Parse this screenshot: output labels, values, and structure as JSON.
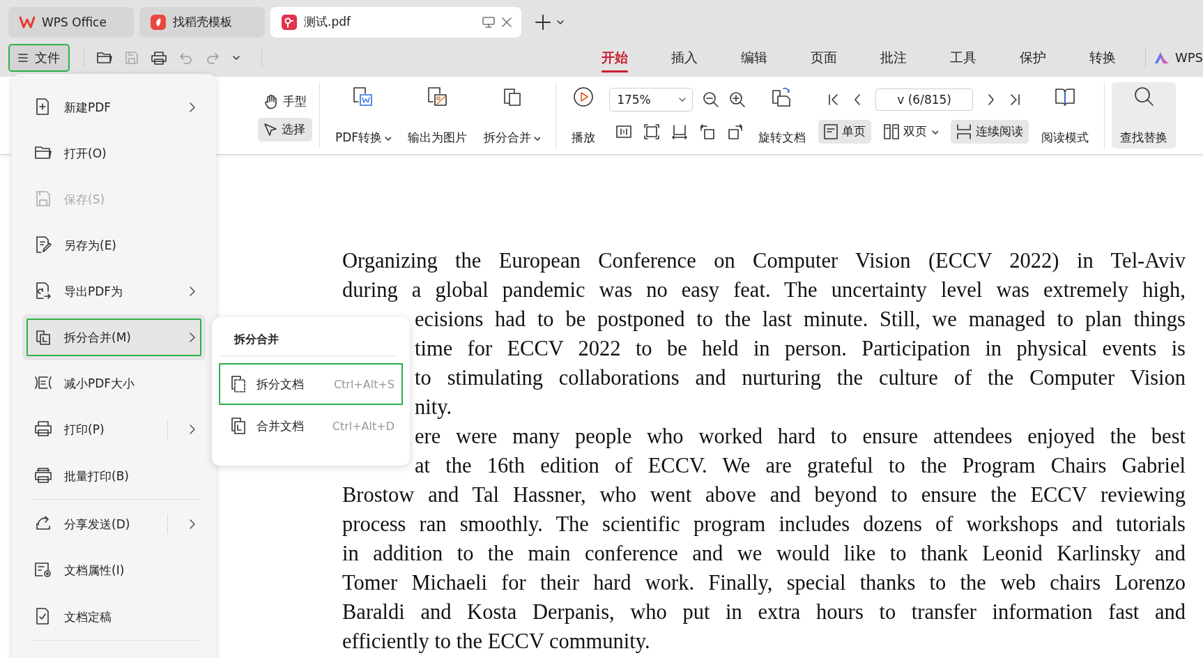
{
  "tabs": [
    {
      "label": "WPS Office",
      "selected": false,
      "closable": false
    },
    {
      "label": "找稻壳模板",
      "selected": false,
      "closable": false
    },
    {
      "label": "测试.pdf",
      "selected": true,
      "closable": true
    }
  ],
  "file_button": {
    "label": "文件",
    "highlighted": true
  },
  "ribbon_tabs": [
    {
      "label": "开始",
      "selected": true
    },
    {
      "label": "插入",
      "selected": false
    },
    {
      "label": "编辑",
      "selected": false
    },
    {
      "label": "页面",
      "selected": false
    },
    {
      "label": "批注",
      "selected": false
    },
    {
      "label": "工具",
      "selected": false
    },
    {
      "label": "保护",
      "selected": false
    },
    {
      "label": "转换",
      "selected": false
    }
  ],
  "account": "WPS",
  "ribbon": {
    "hand": {
      "label": "手型",
      "selected": false
    },
    "select": {
      "label": "选择",
      "selected": true
    },
    "big_buttons": [
      {
        "label": "PDF转换",
        "has_menu": true
      },
      {
        "label": "输出为图片",
        "has_menu": false
      },
      {
        "label": "拆分合并",
        "has_menu": true
      },
      {
        "label": "播放",
        "has_menu": false
      }
    ],
    "zoom": "175%",
    "rotate": "旋转文档",
    "page_field": "v (6/815)",
    "view_buttons": [
      {
        "label": "单页",
        "selected": true,
        "has_menu": false
      },
      {
        "label": "双页",
        "selected": false,
        "has_menu": true
      },
      {
        "label": "连续阅读",
        "selected": true,
        "has_menu": false
      }
    ],
    "read_mode": "阅读模式",
    "find": {
      "label": "查找替换",
      "selected": true
    }
  },
  "file_menu": [
    {
      "label": "新建PDF",
      "disabled": false,
      "submenu": true,
      "split": false,
      "highlighted": false,
      "separator_after": false
    },
    {
      "label": "打开(O)",
      "disabled": false,
      "submenu": false,
      "split": false,
      "highlighted": false,
      "separator_after": false
    },
    {
      "label": "保存(S)",
      "disabled": true,
      "submenu": false,
      "split": false,
      "highlighted": false,
      "separator_after": false
    },
    {
      "label": "另存为(E)",
      "disabled": false,
      "submenu": false,
      "split": false,
      "highlighted": false,
      "separator_after": false
    },
    {
      "label": "导出PDF为",
      "disabled": false,
      "submenu": true,
      "split": false,
      "highlighted": false,
      "separator_after": false
    },
    {
      "label": "拆分合并(M)",
      "disabled": false,
      "submenu": true,
      "split": false,
      "highlighted": true,
      "separator_after": false
    },
    {
      "label": "减小PDF大小",
      "disabled": false,
      "submenu": false,
      "split": false,
      "highlighted": false,
      "separator_after": false
    },
    {
      "label": "打印(P)",
      "disabled": false,
      "submenu": true,
      "split": true,
      "highlighted": false,
      "separator_after": false
    },
    {
      "label": "批量打印(B)",
      "disabled": false,
      "submenu": false,
      "split": false,
      "highlighted": false,
      "separator_after": true
    },
    {
      "label": "分享发送(D)",
      "disabled": false,
      "submenu": true,
      "split": true,
      "highlighted": false,
      "separator_after": false
    },
    {
      "label": "文档属性(I)",
      "disabled": false,
      "submenu": false,
      "split": false,
      "highlighted": false,
      "separator_after": false
    },
    {
      "label": "文档定稿",
      "disabled": false,
      "submenu": false,
      "split": false,
      "highlighted": false,
      "separator_after": true
    }
  ],
  "submenu": {
    "title": "拆分合并",
    "items": [
      {
        "label": "拆分文档",
        "shortcut": "Ctrl+Alt+S",
        "selected": true
      },
      {
        "label": "合并文档",
        "shortcut": "Ctrl+Alt+D",
        "selected": false
      }
    ]
  },
  "document_lines": [
    {
      "text": "Organizing the European Conference on Computer Vision (ECCV 2022) in Tel-Aviv",
      "covered": false,
      "paragraph_end": false
    },
    {
      "text": "during a global pandemic was no easy feat. The uncertainty level was extremely high,",
      "covered": false,
      "paragraph_end": false
    },
    {
      "text": "ecisions had to be postponed to the last minute. Still, we managed to plan things",
      "covered": true,
      "paragraph_end": false
    },
    {
      "text": "time for ECCV 2022 to be held in person. Participation in physical events is",
      "covered": true,
      "paragraph_end": false
    },
    {
      "text": "to stimulating collaborations and nurturing the culture of the Computer Vision",
      "covered": true,
      "paragraph_end": false
    },
    {
      "text": "nity.",
      "covered": true,
      "paragraph_end": true
    },
    {
      "text": "ere were many people who worked hard to ensure attendees enjoyed the best",
      "covered": true,
      "paragraph_end": false
    },
    {
      "text": "at the 16th edition of ECCV. We are grateful to the Program Chairs Gabriel",
      "covered": true,
      "paragraph_end": false
    },
    {
      "text": "Brostow and Tal Hassner, who went above and beyond to ensure the ECCV reviewing",
      "covered": false,
      "paragraph_end": false
    },
    {
      "text": "process ran smoothly. The scientific program includes dozens of workshops and tutorials",
      "covered": false,
      "paragraph_end": false
    },
    {
      "text": "in addition to the main conference and we would like to thank Leonid Karlinsky and",
      "covered": false,
      "paragraph_end": false
    },
    {
      "text": "Tomer Michaeli for their hard work. Finally, special thanks to the web chairs Lorenzo",
      "covered": false,
      "paragraph_end": false
    },
    {
      "text": "Baraldi and Kosta Derpanis, who put in extra hours to transfer information fast and",
      "covered": false,
      "paragraph_end": false
    },
    {
      "text": "efficiently to the ECCV community.",
      "covered": false,
      "paragraph_end": true
    }
  ]
}
